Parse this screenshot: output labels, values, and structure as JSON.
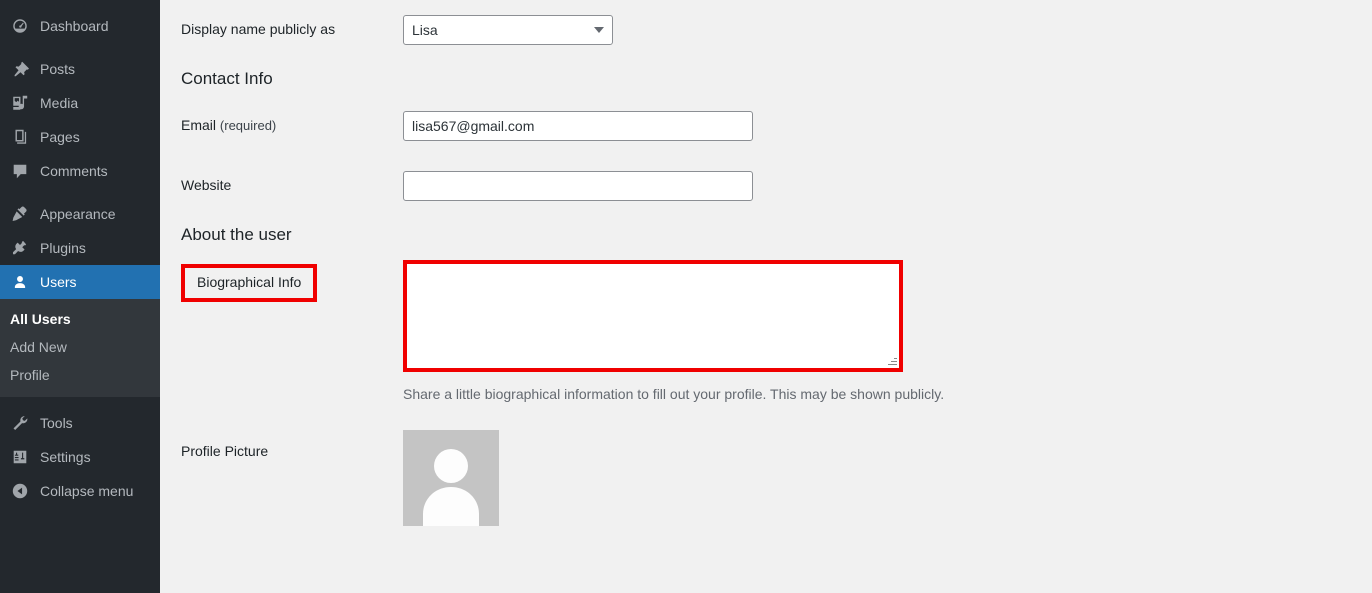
{
  "sidebar": {
    "items": [
      {
        "label": "Dashboard",
        "icon": "dashboard-icon",
        "name": "dashboard",
        "current": false
      },
      {
        "label": "Posts",
        "icon": "pin-icon",
        "name": "posts",
        "current": false
      },
      {
        "label": "Media",
        "icon": "media-icon",
        "name": "media",
        "current": false
      },
      {
        "label": "Pages",
        "icon": "pages-icon",
        "name": "pages",
        "current": false
      },
      {
        "label": "Comments",
        "icon": "comments-icon",
        "name": "comments",
        "current": false
      },
      {
        "label": "Appearance",
        "icon": "appearance-icon",
        "name": "appearance",
        "current": false
      },
      {
        "label": "Plugins",
        "icon": "plugins-icon",
        "name": "plugins",
        "current": false
      },
      {
        "label": "Users",
        "icon": "users-icon",
        "name": "users",
        "current": true
      },
      {
        "label": "Tools",
        "icon": "tools-icon",
        "name": "tools",
        "current": false
      },
      {
        "label": "Settings",
        "icon": "settings-icon",
        "name": "settings",
        "current": false
      },
      {
        "label": "Collapse menu",
        "icon": "collapse-icon",
        "name": "collapse-menu",
        "current": false
      }
    ],
    "submenu": {
      "all_users": "All Users",
      "add_new": "Add New",
      "profile": "Profile"
    },
    "colors": {
      "background": "#23282d",
      "submenu_background": "#32373c",
      "current_background": "#2271b1",
      "text": "#b4b9be"
    }
  },
  "form": {
    "display_name": {
      "label": "Display name publicly as",
      "value": "Lisa",
      "options": [
        "Lisa"
      ]
    },
    "contact_info_heading": "Contact Info",
    "email": {
      "label": "Email",
      "required_note": "(required)",
      "value": "lisa567@gmail.com",
      "placeholder": ""
    },
    "website": {
      "label": "Website",
      "value": "",
      "placeholder": ""
    },
    "about_heading": "About the user",
    "biographical_info": {
      "label": "Biographical Info",
      "value": "",
      "placeholder": "",
      "description": "Share a little biographical information to fill out your profile. This may be shown publicly."
    },
    "profile_picture": {
      "label": "Profile Picture",
      "avatar_alt": "default-avatar"
    }
  },
  "highlight": {
    "color": "#f00000",
    "targets": [
      "biographical-info-label",
      "biographical-info-textarea"
    ]
  }
}
